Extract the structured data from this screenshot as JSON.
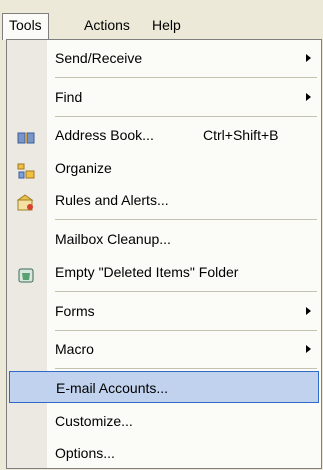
{
  "menubar": {
    "items": [
      {
        "label": "Tools"
      },
      {
        "label": "Actions"
      },
      {
        "label": "Help"
      }
    ]
  },
  "tools_menu": {
    "items": [
      {
        "label": "Send/Receive",
        "has_submenu": true
      },
      {
        "label": "Find",
        "has_submenu": true
      },
      {
        "label": "Address Book...",
        "shortcut": "Ctrl+Shift+B",
        "icon": "address-book-icon"
      },
      {
        "label": "Organize",
        "icon": "organize-icon"
      },
      {
        "label": "Rules and Alerts...",
        "icon": "rules-alerts-icon"
      },
      {
        "label": "Mailbox Cleanup..."
      },
      {
        "label": "Empty \"Deleted Items\" Folder",
        "icon": "deleted-items-icon"
      },
      {
        "label": "Forms",
        "has_submenu": true
      },
      {
        "label": "Macro",
        "has_submenu": true
      },
      {
        "label": "E-mail Accounts...",
        "highlighted": true
      },
      {
        "label": "Customize..."
      },
      {
        "label": "Options..."
      }
    ]
  },
  "colors": {
    "menu_bg": "#fbfbf8",
    "gutter": "#ebe9e2",
    "highlight_bg": "#c1d2ee",
    "highlight_border": "#316ac5"
  }
}
